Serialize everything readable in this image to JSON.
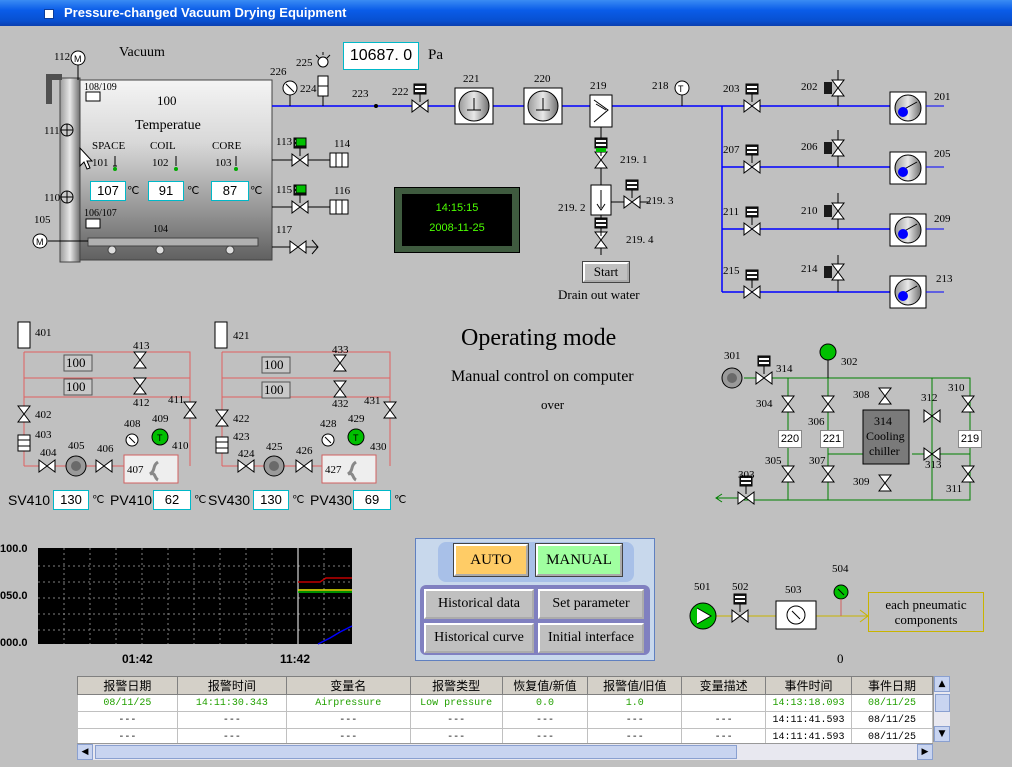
{
  "window": {
    "title": "Pressure-changed Vacuum Drying Equipment"
  },
  "chamber": {
    "vacuum_label": "Vacuum",
    "vessel_id": "100",
    "temperature_label": "Temperatue",
    "space_label": "SPACE",
    "coil_label": "COIL",
    "core_label": "CORE",
    "space_id": "101",
    "coil_id": "102",
    "core_id": "103",
    "space_value": "107",
    "coil_value": "91",
    "core_value": "87",
    "unit": "℃",
    "tag_104": "104",
    "tag_105": "105",
    "tag_106_107": "106/107",
    "tag_108_109": "108/109",
    "tag_110": "110",
    "tag_111": "111",
    "tag_112": "112"
  },
  "pressure": {
    "value": "10687. 0",
    "unit": "Pa"
  },
  "clock": {
    "time": "14:15:15",
    "date": "2008-11-25"
  },
  "tags": {
    "t113": "113",
    "t114": "114",
    "t115": "115",
    "t116": "116",
    "t117": "117",
    "t221": "221",
    "t220": "220",
    "t219": "219",
    "t218": "218",
    "t222": "222",
    "t223": "223",
    "t224": "224",
    "t225": "225",
    "t226": "226",
    "t2191": "219. 1",
    "t2192": "219. 2",
    "t2193": "219. 3",
    "t2194": "219. 4",
    "t201": "201",
    "t202": "202",
    "t203": "203",
    "t205": "205",
    "t206": "206",
    "t207": "207",
    "t209": "209",
    "t210": "210",
    "t211": "211",
    "t213": "213",
    "t214": "214",
    "t215": "215"
  },
  "drain": {
    "start_label": "Start",
    "caption": "Drain out water"
  },
  "mode": {
    "title": "Operating mode",
    "subtitle": "Manual control on computer",
    "status": "over"
  },
  "oil_left": {
    "t401": "401",
    "t402": "402",
    "t403": "403",
    "t404": "404",
    "t405": "405",
    "t406": "406",
    "t407": "407",
    "t408": "408",
    "t409": "409",
    "t410": "410",
    "t411": "411",
    "t412": "412",
    "t413": "413",
    "box1": "100",
    "box2": "100",
    "sv_label": "SV410",
    "sv_value": "130",
    "pv_label": "PV410",
    "pv_value": "62",
    "unit": "℃"
  },
  "oil_right": {
    "t421": "421",
    "t422": "422",
    "t423": "423",
    "t424": "424",
    "t425": "425",
    "t426": "426",
    "t427": "427",
    "t428": "428",
    "t429": "429",
    "t430": "430",
    "t431": "431",
    "t432": "432",
    "t433": "433",
    "box1": "100",
    "box2": "100",
    "sv_label": "SV430",
    "sv_value": "130",
    "pv_label": "PV430",
    "pv_value": "69",
    "unit": "℃"
  },
  "cooling": {
    "t301": "301",
    "t302": "302",
    "t303": "303",
    "t304": "304",
    "t305": "305",
    "t306": "306",
    "t307": "307",
    "t308": "308",
    "t309": "309",
    "t310": "310",
    "t311": "311",
    "t312": "312",
    "t313": "313",
    "t314": "314",
    "box220": "220",
    "box221": "221",
    "box219": "219",
    "chiller_id": "314",
    "chiller_l1": "Cooling",
    "chiller_l2": "chiller"
  },
  "trend": {
    "y_top": "100.0",
    "y_mid": "050.0",
    "y_bot": "000.0",
    "t_start": "01:42",
    "t_end": "11:42",
    "colors": {
      "red": "#c00000",
      "yellow": "#e8e800",
      "green": "#00c000",
      "blue": "#0000ff"
    }
  },
  "controls": {
    "auto_label": "AUTO",
    "manual_label": "MANUAL",
    "historical_data": "Historical data",
    "set_parameter": "Set parameter",
    "historical_curve": "Historical curve",
    "initial_interface": "Initial interface"
  },
  "pneumatic": {
    "t501": "501",
    "t502": "502",
    "t503": "503",
    "t504": "504",
    "box_l1": "each pneumatic",
    "box_l2": "components",
    "value": "0"
  },
  "events": {
    "headers": [
      "报警日期",
      "报警时间",
      "变量名",
      "报警类型",
      "恢复值/新值",
      "报警值/旧值",
      "变量描述",
      "事件时间",
      "事件日期"
    ],
    "rows": [
      [
        "08/11/25",
        "14:11:30.343",
        "Airpressure",
        "Low pressure",
        "0.0",
        "1.0",
        "",
        "14:13:18.093",
        "08/11/25"
      ],
      [
        "---",
        "---",
        "---",
        "---",
        "---",
        "---",
        "---",
        "14:11:41.593",
        "08/11/25"
      ],
      [
        "---",
        "---",
        "---",
        "---",
        "---",
        "---",
        "---",
        "14:11:41.593",
        "08/11/25"
      ]
    ]
  }
}
